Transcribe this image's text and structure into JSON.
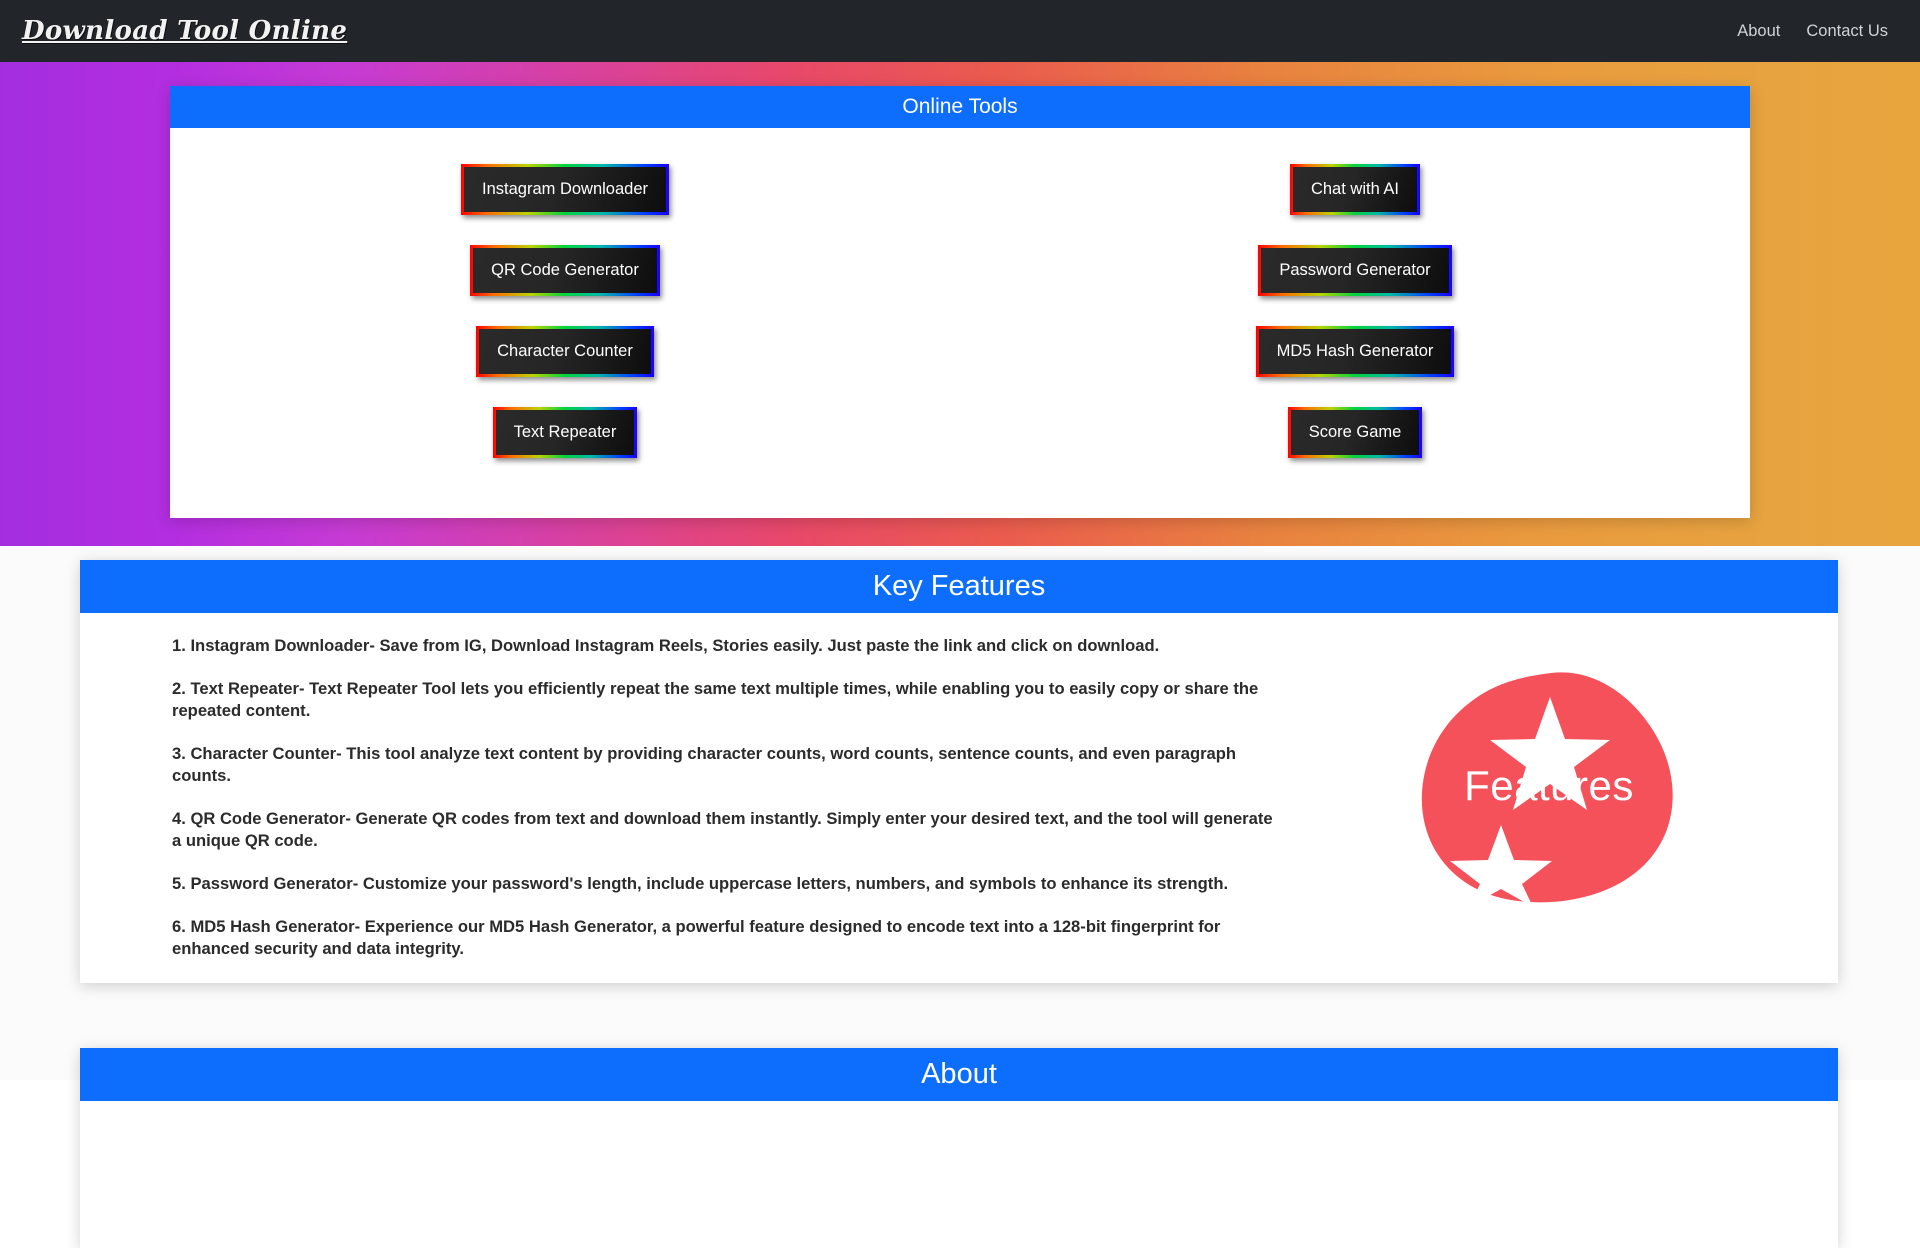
{
  "navbar": {
    "brand": "Download Tool Online",
    "links": [
      {
        "label": "About"
      },
      {
        "label": "Contact Us"
      }
    ]
  },
  "theme": {
    "accent_blue": "#0d6efd",
    "navbar_bg": "#22262a",
    "blob_red": "#f5515b",
    "button_dark": "#1a1a1a",
    "hero_gradient_from": "#a32ee0",
    "hero_gradient_mid": "#e8486a",
    "hero_gradient_to": "#e8a53e"
  },
  "tools": {
    "header": "Online Tools",
    "left_column": [
      {
        "label": "Instagram Downloader"
      },
      {
        "label": "QR Code Generator"
      },
      {
        "label": "Character Counter"
      },
      {
        "label": "Text Repeater"
      }
    ],
    "right_column": [
      {
        "label": "Chat with AI"
      },
      {
        "label": "Password Generator"
      },
      {
        "label": "MD5 Hash Generator"
      },
      {
        "label": "Score Game"
      }
    ]
  },
  "features": {
    "header": "Key Features",
    "items": [
      {
        "text": "1. Instagram Downloader- Save from IG, Download Instagram Reels, Stories easily. Just paste the link and click on download."
      },
      {
        "text": "2. Text Repeater- Text Repeater Tool lets you efficiently repeat the same text multiple times, while enabling you to easily copy or share the repeated content."
      },
      {
        "text": "3. Character Counter- This tool analyze text content by providing character counts, word counts, sentence counts, and even paragraph counts."
      },
      {
        "text": "4. QR Code Generator- Generate QR codes from text and download them instantly. Simply enter your desired text, and the tool will generate a unique QR code."
      },
      {
        "text": "5. Password Generator- Customize your password's length, include uppercase letters, numbers, and symbols to enhance its strength."
      },
      {
        "text": "6. MD5 Hash Generator- Experience our MD5 Hash Generator, a powerful feature designed to encode text into a 128-bit fingerprint for enhanced security and data integrity."
      }
    ],
    "art_label": "Features"
  },
  "about": {
    "header": "About"
  }
}
